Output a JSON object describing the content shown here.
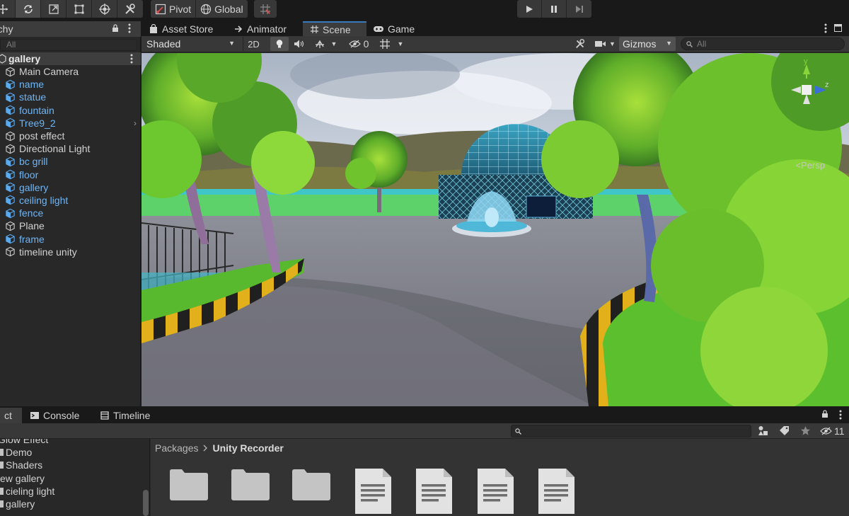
{
  "toolbar": {
    "pivot_label": "Pivot",
    "global_label": "Global"
  },
  "hierarchy": {
    "tab_label": "rchy",
    "search_placeholder": "All",
    "scene_name": "gallery",
    "items": [
      {
        "label": "Main Camera",
        "prefab": false
      },
      {
        "label": "name",
        "prefab": true
      },
      {
        "label": "statue",
        "prefab": true
      },
      {
        "label": "fountain",
        "prefab": true
      },
      {
        "label": "Tree9_2",
        "prefab": true
      },
      {
        "label": "post effect",
        "prefab": false
      },
      {
        "label": "Directional Light",
        "prefab": false
      },
      {
        "label": "bc grill",
        "prefab": true
      },
      {
        "label": "floor",
        "prefab": true
      },
      {
        "label": "gallery",
        "prefab": true
      },
      {
        "label": "ceiling light",
        "prefab": true
      },
      {
        "label": "fence",
        "prefab": true
      },
      {
        "label": "Plane",
        "prefab": false
      },
      {
        "label": "frame",
        "prefab": true
      },
      {
        "label": "timeline unity",
        "prefab": false
      }
    ]
  },
  "scene": {
    "tabs": [
      "Asset Store",
      "Animator",
      "Scene",
      "Game"
    ],
    "active_tab": "Scene",
    "shading_mode": "Shaded",
    "mode_2d": "2D",
    "hidden_count": "0",
    "gizmos_label": "Gizmos",
    "search_placeholder": "All",
    "projection_label": "<Persp",
    "axis_y": "y",
    "axis_z": "z"
  },
  "project": {
    "tabs": [
      "ct",
      "Console",
      "Timeline"
    ],
    "hidden_count": "11",
    "folders": [
      "Glow Effect",
      "Demo",
      "Shaders",
      "ew gallery",
      "cieling light",
      "gallery"
    ],
    "breadcrumb": [
      "Packages",
      "Unity Recorder"
    ],
    "assets": [
      "folder",
      "folder",
      "folder",
      "document",
      "document",
      "document",
      "document"
    ]
  }
}
